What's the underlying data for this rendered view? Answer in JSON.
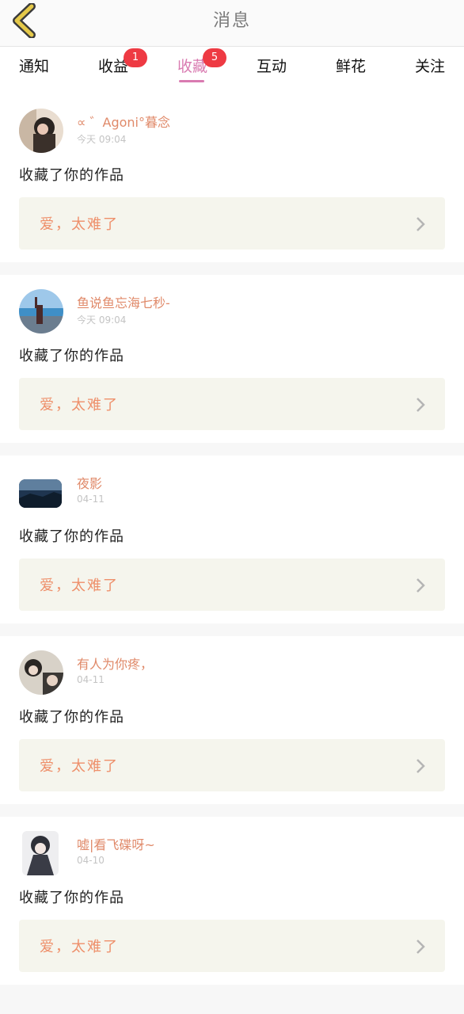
{
  "header": {
    "title": "消息"
  },
  "tabs": [
    {
      "label": "通知",
      "badge": null,
      "active": false
    },
    {
      "label": "收益",
      "badge": "1",
      "active": false
    },
    {
      "label": "收藏",
      "badge": "5",
      "active": true
    },
    {
      "label": "互动",
      "badge": null,
      "active": false
    },
    {
      "label": "鲜花",
      "badge": null,
      "active": false
    },
    {
      "label": "关注",
      "badge": null,
      "active": false
    }
  ],
  "feed": [
    {
      "name": "∝ ゛Agoni°暮念",
      "time": "今天 09:04",
      "action": "收藏了你的作品",
      "work_title": "爱，太难了"
    },
    {
      "name": "鱼说鱼忘海七秒-",
      "time": "今天 09:04",
      "action": "收藏了你的作品",
      "work_title": "爱，太难了"
    },
    {
      "name": "夜影",
      "time": "04-11",
      "action": "收藏了你的作品",
      "work_title": "爱，太难了"
    },
    {
      "name": "有人为你疼，",
      "time": "04-11",
      "action": "收藏了你的作品",
      "work_title": "爱，太难了"
    },
    {
      "name": "嘘|看飞碟呀~",
      "time": "04-10",
      "action": "收藏了你的作品",
      "work_title": "爱，太难了"
    }
  ],
  "colors": {
    "accent": "#d97bb1",
    "badge": "#ee3a43",
    "username": "#e08a6a",
    "work_title": "#ee8f6a",
    "work_bg": "#f5f5ed",
    "back_icon": "#e5c94a"
  },
  "icons": {
    "back": "back-arrow-icon",
    "chevron": "chevron-right-icon"
  }
}
